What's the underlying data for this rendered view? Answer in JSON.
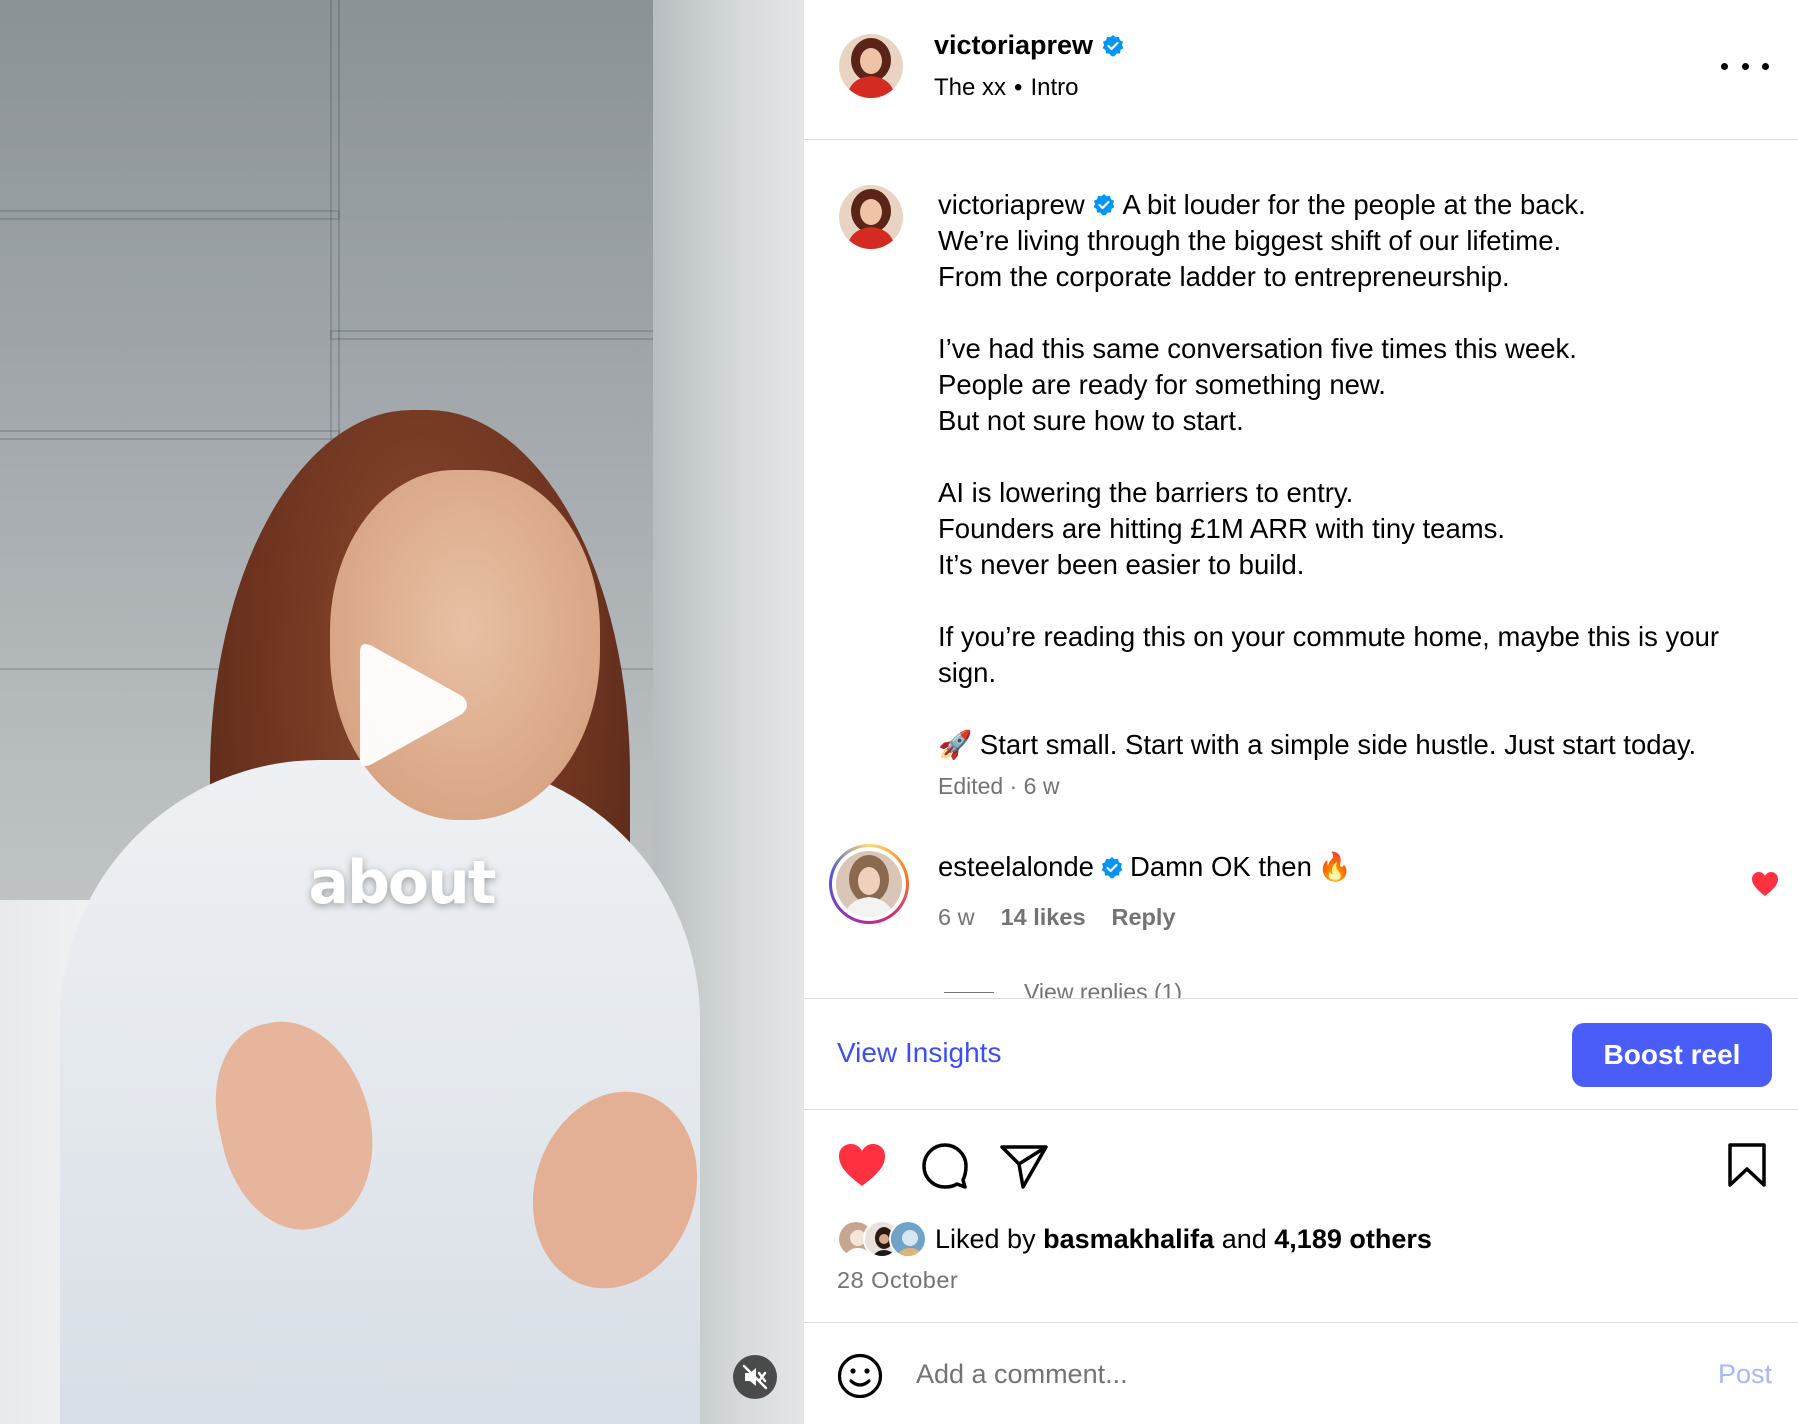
{
  "video": {
    "caption_word": "about"
  },
  "header": {
    "username": "victoriaprew",
    "audio_artist": "The xx",
    "audio_separator": "•",
    "audio_track": "Intro"
  },
  "caption": {
    "username": "victoriaprew",
    "lines": [
      "A bit louder for the people at the back.",
      "We’re living through the biggest shift of our lifetime.",
      "From the corporate ladder to entrepreneurship.",
      "",
      "I’ve had this same conversation five times this week.",
      "People are ready for something new.",
      "But not sure how to start.",
      "",
      "AI is lowering the barriers to entry.",
      "Founders are hitting £1M ARR with tiny teams.",
      "It’s never been easier to build.",
      "",
      "If you’re reading this on your commute home, maybe this is your sign.",
      "",
      "🚀 Start small. Start with a simple side hustle. Just start today."
    ],
    "meta": "Edited · 6 w"
  },
  "comment": {
    "username": "esteelalonde",
    "text": "Damn OK then",
    "emoji": "🔥",
    "age": "6 w",
    "likes": "14 likes",
    "reply_label": "Reply",
    "view_replies": "View replies (1)",
    "liked_by_author": true
  },
  "actions_bar": {
    "insights_label": "View Insights",
    "boost_label": "Boost reel"
  },
  "engagement": {
    "liked": true,
    "liked_by_prefix": "Liked by",
    "liked_by_user": "basmakhalifa",
    "liked_by_and": "and",
    "liked_by_others": "4,189 others",
    "date": "28 October"
  },
  "add_comment": {
    "placeholder": "Add a comment...",
    "post_label": "Post"
  },
  "colors": {
    "verified": "#0095f6",
    "like_red": "#ff3040",
    "boost": "#4a5df9",
    "link_blue": "#3c4ff0",
    "muted": "#737373"
  },
  "icons": [
    "play-icon",
    "mute-icon",
    "verified-icon",
    "more-icon",
    "heart-icon",
    "comment-icon",
    "share-icon",
    "bookmark-icon",
    "emoji-icon"
  ]
}
